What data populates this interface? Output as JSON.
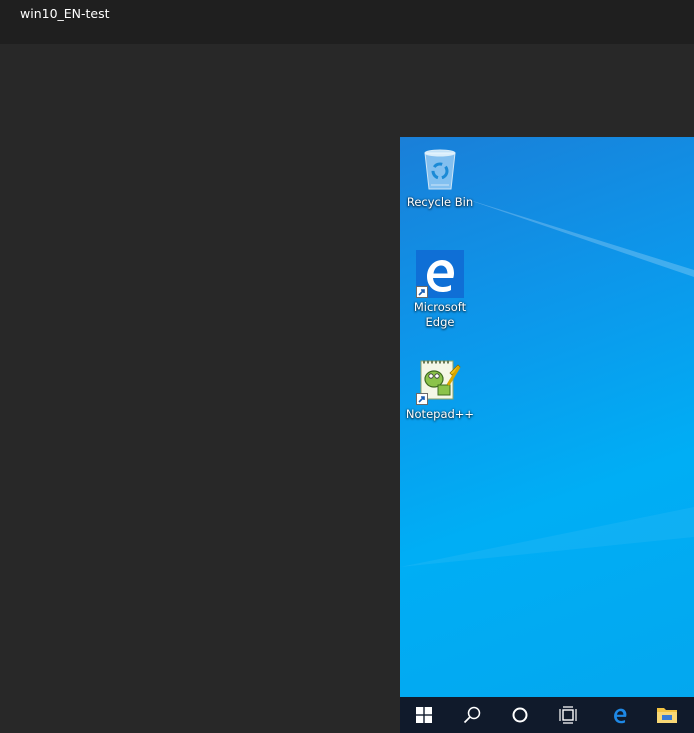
{
  "window": {
    "title": "win10_EN-test"
  },
  "desktop": {
    "icons": [
      {
        "label": "Recycle Bin",
        "icon": "recycle-bin-icon"
      },
      {
        "label": "Microsoft\nEdge",
        "icon": "edge-icon",
        "shortcut": true
      },
      {
        "label": "Notepad++",
        "icon": "notepad-plus-plus-icon",
        "shortcut": true
      }
    ]
  },
  "taskbar": {
    "items": [
      {
        "icon": "windows-start-icon"
      },
      {
        "icon": "search-icon"
      },
      {
        "icon": "cortana-icon"
      },
      {
        "icon": "task-view-icon"
      },
      {
        "icon": "edge-icon"
      },
      {
        "icon": "file-explorer-icon"
      }
    ]
  },
  "colors": {
    "wallpaper": "#0d96ea",
    "taskbar": "#101a2b",
    "edge_blue": "#0f6fd6",
    "frame": "#272727"
  }
}
